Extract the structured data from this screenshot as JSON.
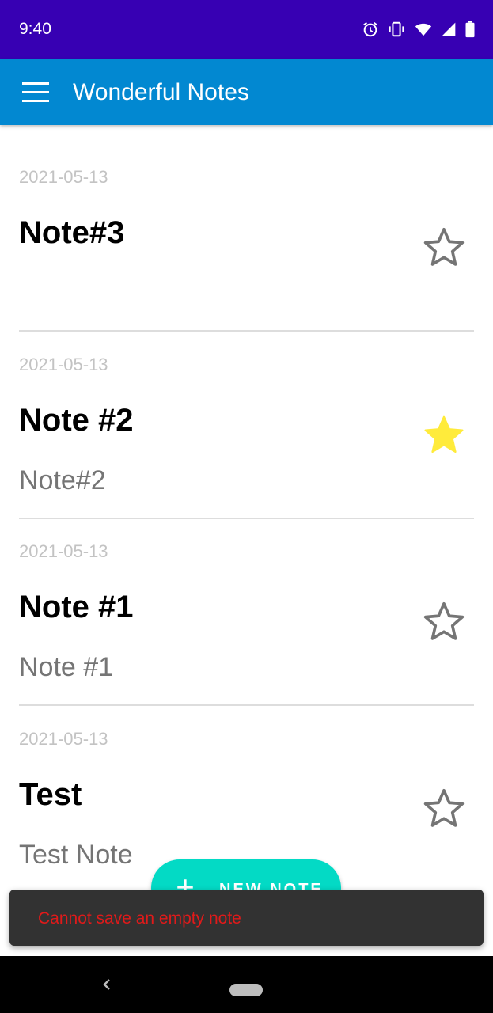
{
  "status_bar": {
    "time": "9:40",
    "icons": [
      "alarm-icon",
      "vibrate-icon",
      "wifi-icon",
      "signal-icon",
      "battery-icon"
    ]
  },
  "app_bar": {
    "menu_icon": "menu-icon",
    "title": "Wonderful Notes"
  },
  "notes": [
    {
      "date": "2021-05-13",
      "title": "Note#3",
      "body": "",
      "starred": false
    },
    {
      "date": "2021-05-13",
      "title": "Note #2",
      "body": "Note#2",
      "starred": true
    },
    {
      "date": "2021-05-13",
      "title": "Note #1",
      "body": "Note #1",
      "starred": false
    },
    {
      "date": "2021-05-13",
      "title": "Test",
      "body": "Test Note",
      "starred": false
    }
  ],
  "fab": {
    "icon": "plus-icon",
    "label": "NEW NOTE"
  },
  "snackbar": {
    "message": "Cannot save an empty note"
  },
  "nav_bar": {
    "back_icon": "back-chevron-icon",
    "home_icon": "home-pill-icon"
  },
  "colors": {
    "status_bar": "#3700b3",
    "app_bar": "#0288d1",
    "fab": "#03dac5",
    "star_filled": "#ffeb3b",
    "star_outline": "#757575",
    "snackbar_bg": "#323232",
    "snackbar_text": "#e01a1a"
  }
}
